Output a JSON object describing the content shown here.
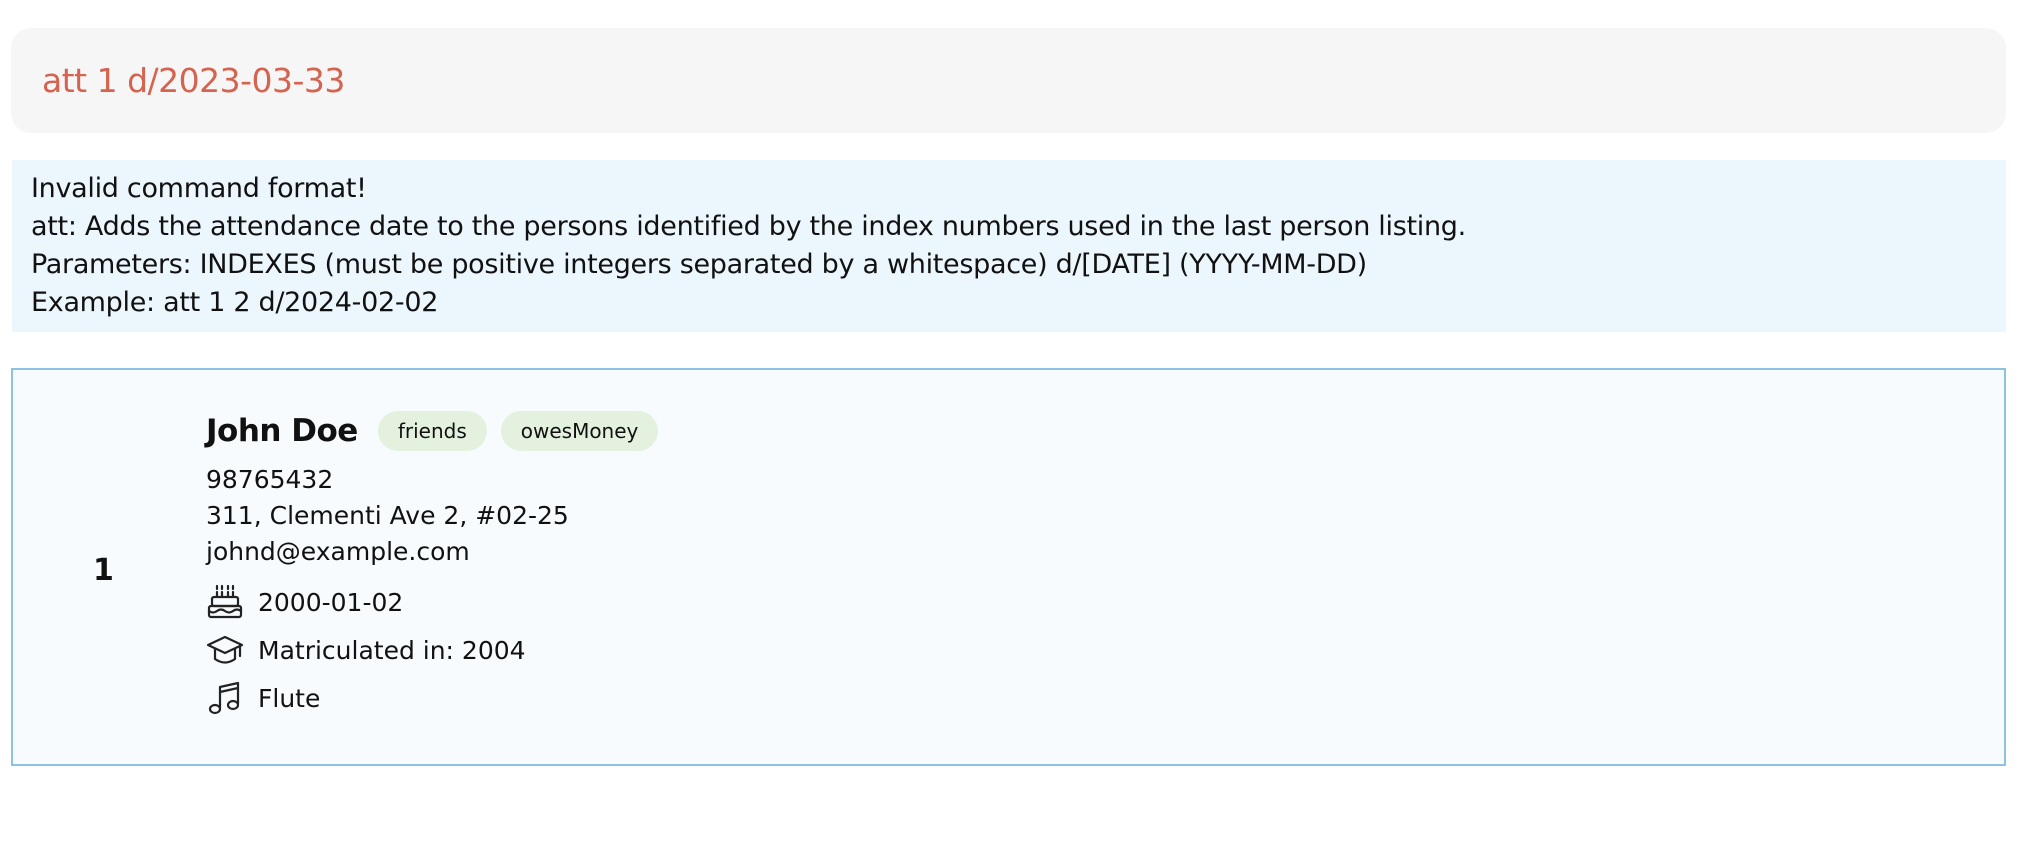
{
  "command": {
    "value": "att 1 d/2023-03-33"
  },
  "result": {
    "lines": [
      "Invalid command format!",
      "att: Adds the attendance date to the persons identified by the index numbers used in the last person listing.",
      "Parameters: INDEXES (must be positive integers separated by a whitespace) d/[DATE] (YYYY-MM-DD)",
      "Example: att 1 2 d/2024-02-02"
    ]
  },
  "persons": [
    {
      "index": "1",
      "name": "John Doe",
      "tags": [
        "friends",
        "owesMoney"
      ],
      "phone": "98765432",
      "address": "311, Clementi Ave 2, #02-25",
      "email": "johnd@example.com",
      "birthday": {
        "icon": "birthday-cake-icon",
        "text": "2000-01-02"
      },
      "matriculation": {
        "icon": "graduation-cap-icon",
        "text": "Matriculated in: 2004"
      },
      "instrument": {
        "icon": "music-note-icon",
        "text": "Flute"
      }
    }
  ],
  "colors": {
    "command_text": "#d4634f",
    "command_bg": "#f6f6f6",
    "result_bg": "#ecf6fd",
    "card_border": "#8cc3e2",
    "tag_bg": "#e3f1de"
  }
}
